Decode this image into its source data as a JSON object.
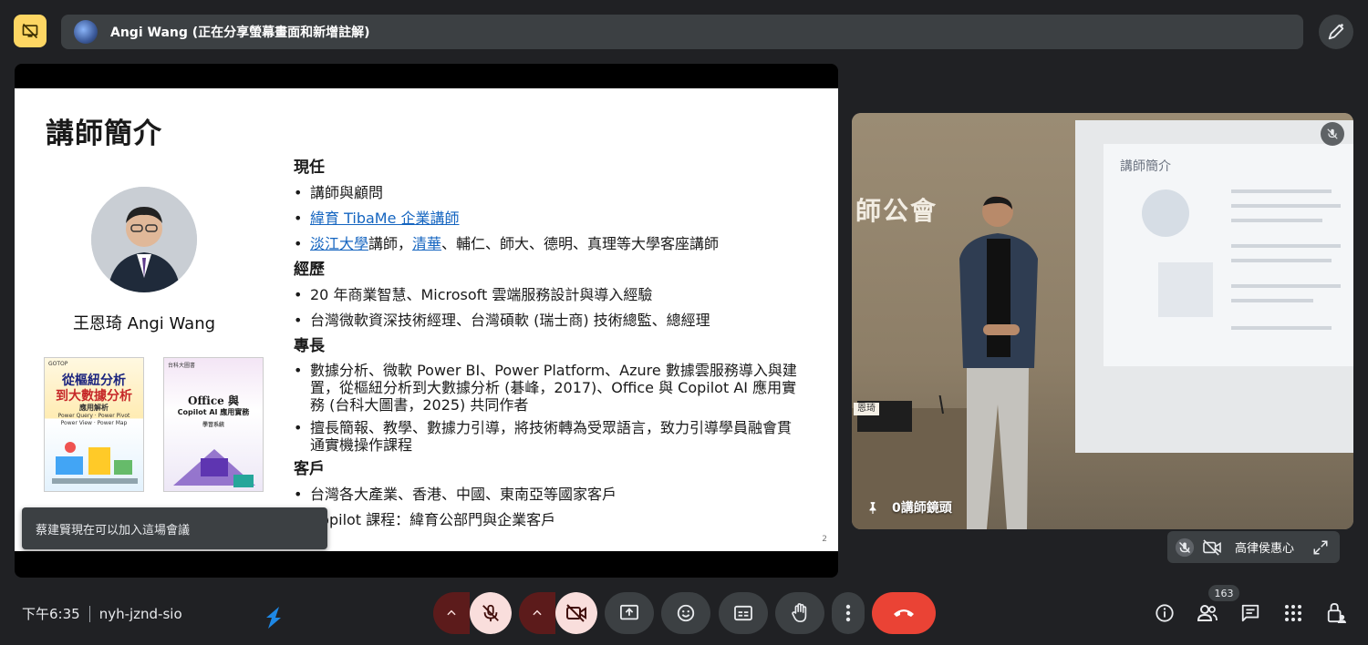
{
  "top_bar": {
    "share_text": "Angi Wang (正在分享螢幕畫面和新增註解)"
  },
  "slide": {
    "title": "講師簡介",
    "presenter_name": "王恩琦 Angi Wang",
    "page_number": "2",
    "book1": {
      "publisher": "GOTOP",
      "title_line1": "從樞紐分析",
      "title_line2": "到大數據分析",
      "subtitle": "應用解析",
      "tagline1": "Power Query · Power Pivot",
      "tagline2": "Power View · Power Map"
    },
    "book2": {
      "publisher": "台科大圖書",
      "title_line1": "Office 與",
      "title_line2": "Copilot AI 應用實務",
      "tag": "學習系統"
    },
    "sections": [
      {
        "heading": "現任",
        "items": [
          {
            "pre": "講師與顧問",
            "link": "",
            "post": ""
          },
          {
            "pre": "",
            "link": "緯育 TibaMe 企業講師",
            "post": ""
          },
          {
            "pre": "",
            "link": "淡江大學",
            "post": "講師，",
            "link2": "清華",
            "post2": "、輔仁、師大、德明、真理等大學客座講師"
          }
        ]
      },
      {
        "heading": "經歷",
        "items": [
          {
            "pre": "20 年商業智慧、Microsoft 雲端服務設計與導入經驗"
          },
          {
            "pre": "台灣微軟資深技術經理、台灣碩軟 (瑞士商) 技術總監、總經理"
          }
        ]
      },
      {
        "heading": "專長",
        "items": [
          {
            "pre": "數據分析、微軟 Power BI、Power Platform、Azure 數據雲服務導入與建置，從樞紐分析到大數據分析 (碁峰，2017)、Office 與 Copilot AI 應用實務 (台科大圖書，2025) 共同作者"
          },
          {
            "pre": "擅長簡報、教學、數據力引導，將技術轉為受眾語言，致力引導學員融會貫通實機操作課程"
          }
        ]
      },
      {
        "heading": "客戶",
        "items": [
          {
            "pre": "台灣各大產業、香港、中國、東南亞等國家客戶"
          },
          {
            "pre": "Copilot 課程：緯育公部門與企業客戶"
          }
        ]
      }
    ]
  },
  "toast": {
    "message": "蔡建賢現在可以加入這場會議"
  },
  "camera_tile": {
    "label": "0講師鏡頭",
    "projected_title": "講師簡介",
    "wall_sign": "師公會",
    "desk_sign": "恩琦"
  },
  "mini_tile": {
    "name": "高律侯惠心"
  },
  "bottom_bar": {
    "time": "下午6:35",
    "meeting_code": "nyh-jznd-sio",
    "participant_count": "163"
  },
  "colors": {
    "background": "#202124",
    "accent_yellow": "#fdd663",
    "end_call": "#ea4335",
    "muted_button": "#f9dedc",
    "link": "#1565c0"
  }
}
